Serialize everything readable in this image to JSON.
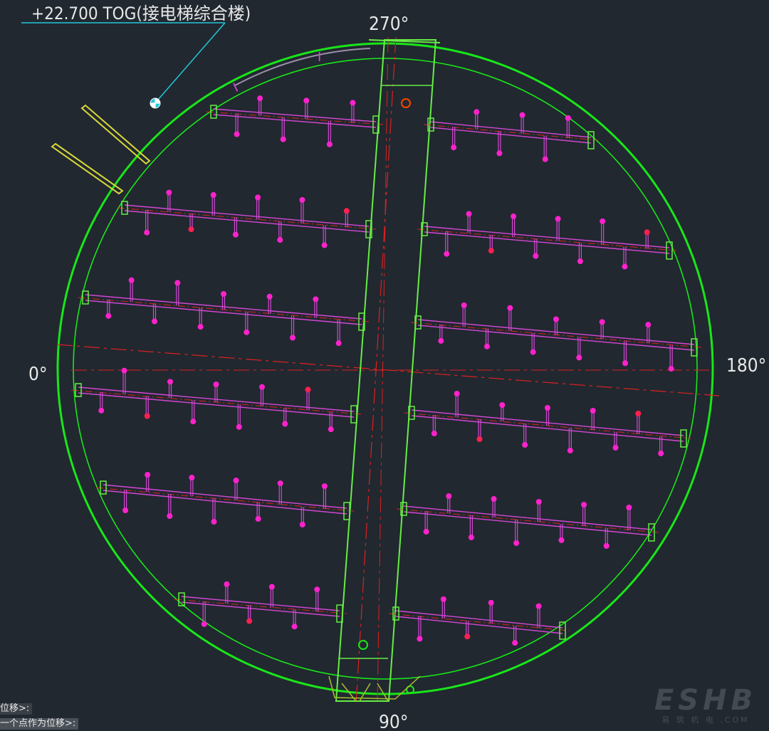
{
  "drawing": {
    "elevation_label": "+22.700 TOG(接电梯综合楼)",
    "angle_top": "270°",
    "angle_left": "0°",
    "angle_right": "180°",
    "angle_bottom": "90°"
  },
  "colors": {
    "background": "#212830",
    "shell": "#19e619",
    "beam": "#66ee44",
    "pipe": "#d447d4",
    "nozzle": "#ff22cc",
    "centerline": "#e02020",
    "leader": "#22c8d8",
    "annotation_text": "#e8e8e8",
    "yellow_member": "#d8d83a"
  },
  "command_line": {
    "line1": "位移>:",
    "line2": "一个点作为位移>:"
  },
  "watermark": {
    "logo": "ESHB",
    "subtitle": "易 筑 机 电 .COM"
  }
}
